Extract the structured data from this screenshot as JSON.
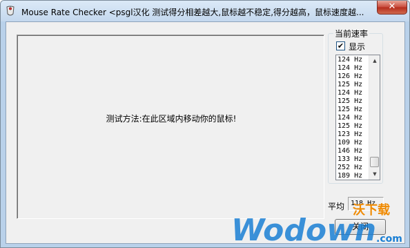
{
  "window": {
    "title": "Mouse Rate Checker <psgl汉化  测试得分相差越大,鼠标越不稳定,得分越高，鼠标速度越..."
  },
  "test_area": {
    "instruction": "测试方法:在此区域内移动你的鼠标!"
  },
  "rate_panel": {
    "group_label": "当前速率",
    "show_label": "显示",
    "show_checked": true,
    "rates": [
      "124 Hz",
      "124 Hz",
      "126 Hz",
      "125 Hz",
      "124 Hz",
      "125 Hz",
      "125 Hz",
      "124 Hz",
      "125 Hz",
      "123 Hz",
      "109 Hz",
      "146 Hz",
      "133 Hz",
      "252 Hz",
      "189 Hz"
    ]
  },
  "average": {
    "label": "平均",
    "value": "118 Hz"
  },
  "buttons": {
    "close_label": "关闭"
  },
  "watermark": {
    "brand": "Wodown",
    "cn": "沃下载",
    "suffix": ".com"
  },
  "colors": {
    "accent_blue": "#1a7fd4",
    "watermark_orange": "#f08a00"
  }
}
